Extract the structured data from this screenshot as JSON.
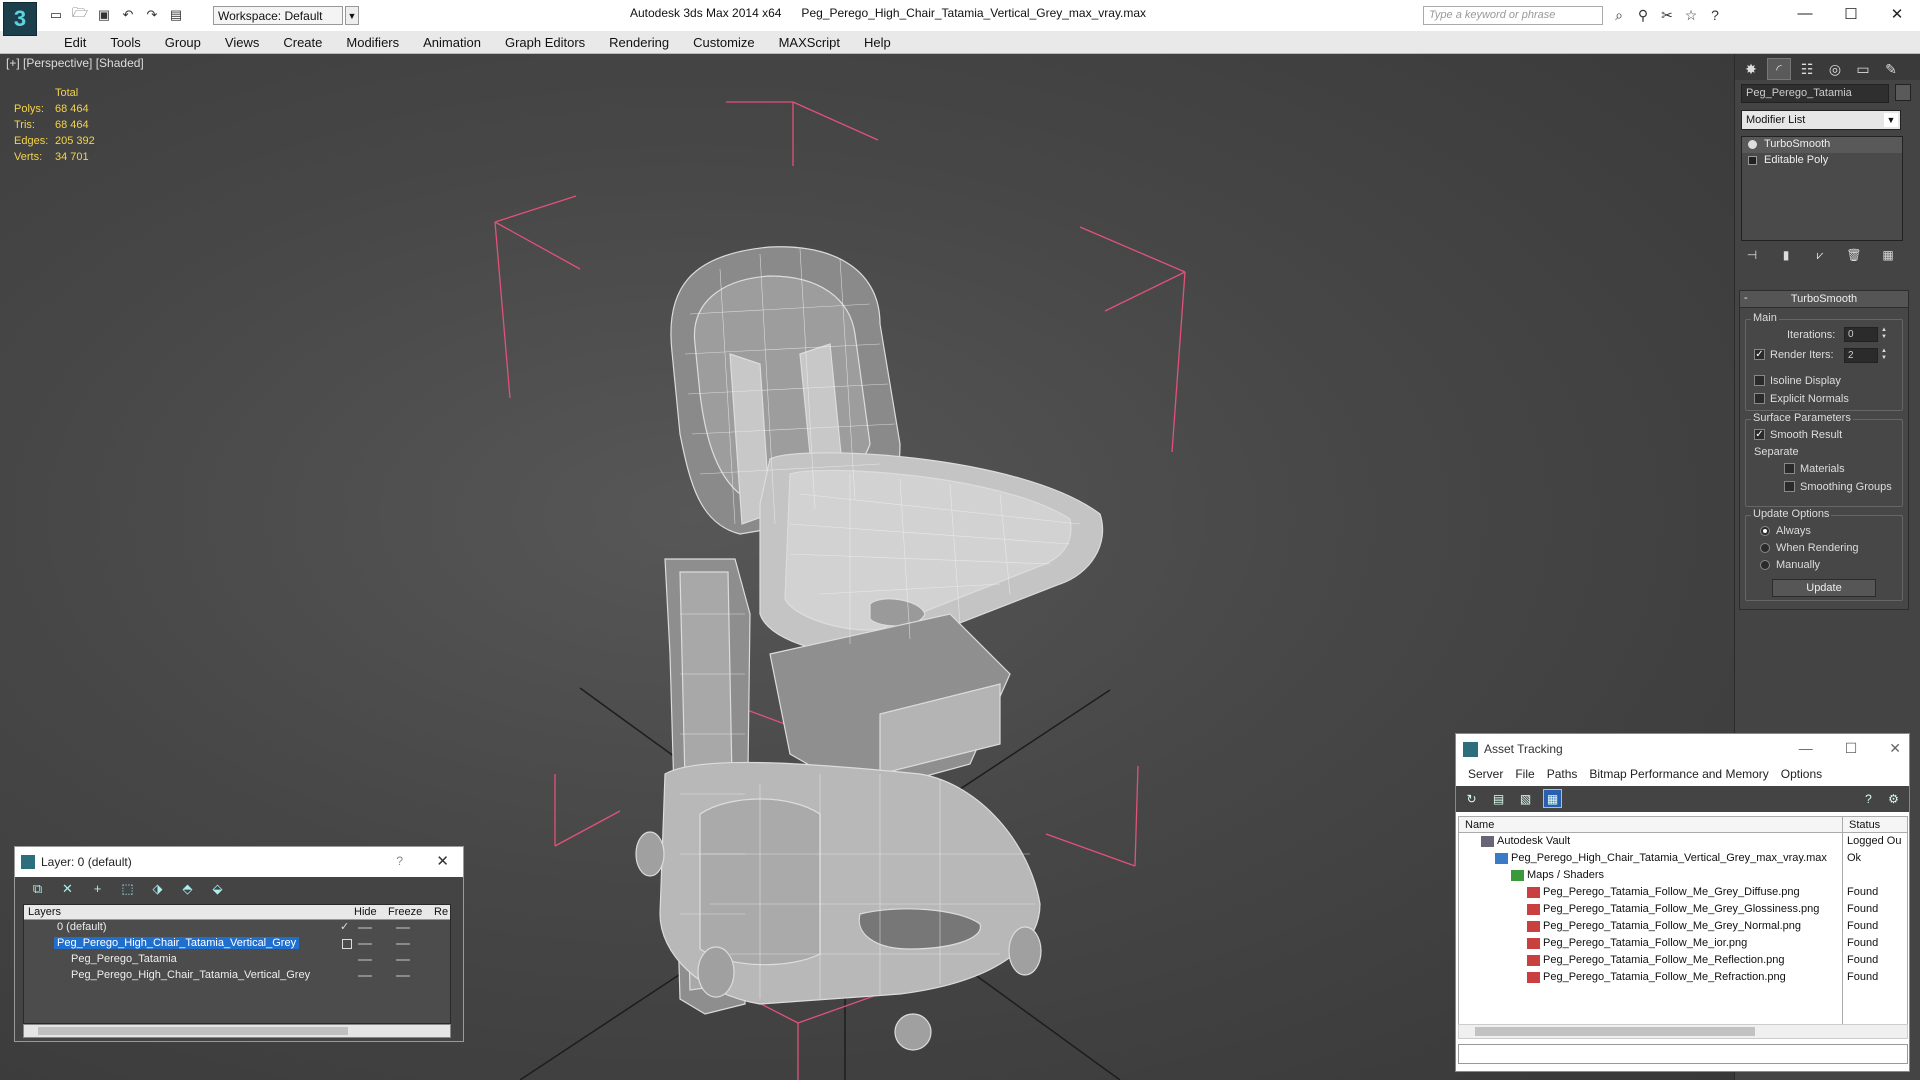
{
  "app": {
    "title": "Autodesk 3ds Max 2014 x64      Peg_Perego_High_Chair_Tatamia_Vertical_Grey_max_vray.max",
    "logo_label": "3",
    "workspace": "Workspace: Default",
    "search_placeholder": "Type a keyword or phrase",
    "window_controls": [
      "—",
      "☐",
      "✕"
    ]
  },
  "menu": [
    "Edit",
    "Tools",
    "Group",
    "Views",
    "Create",
    "Modifiers",
    "Animation",
    "Graph Editors",
    "Rendering",
    "Customize",
    "MAXScript",
    "Help"
  ],
  "viewport": {
    "label": "[+] [Perspective] [Shaded]",
    "stats": {
      "header": "Total",
      "rows": [
        {
          "k": "Polys:",
          "v": "68 464"
        },
        {
          "k": "Tris:",
          "v": "68 464"
        },
        {
          "k": "Edges:",
          "v": "205 392"
        },
        {
          "k": "Verts:",
          "v": "34 701"
        }
      ]
    }
  },
  "command_panel": {
    "object_name": "Peg_Perego_Tatamia",
    "modifier_list": "Modifier List",
    "stack": [
      "TurboSmooth",
      "Editable Poly"
    ],
    "rollout_title": "TurboSmooth",
    "main_label": "Main",
    "iterations_label": "Iterations:",
    "iterations_value": "0",
    "render_iters_label": "Render Iters:",
    "render_iters_value": "2",
    "isoline": "Isoline Display",
    "explicit_normals": "Explicit Normals",
    "surface_params": "Surface Parameters",
    "smooth_result": "Smooth Result",
    "separate": "Separate",
    "materials": "Materials",
    "smoothing_groups": "Smoothing Groups",
    "update_options": "Update Options",
    "always": "Always",
    "when_rendering": "When Rendering",
    "manually": "Manually",
    "update_button": "Update"
  },
  "layer_window": {
    "title": "Layer: 0 (default)",
    "help": "?",
    "columns": [
      "Layers",
      "Hide",
      "Freeze",
      "Re"
    ],
    "rows": [
      {
        "name": "0 (default)",
        "selected": false
      },
      {
        "name": "Peg_Perego_High_Chair_Tatamia_Vertical_Grey",
        "selected": true
      },
      {
        "name": "Peg_Perego_Tatamia",
        "selected": false
      },
      {
        "name": "Peg_Perego_High_Chair_Tatamia_Vertical_Grey",
        "selected": false
      }
    ]
  },
  "asset_tracking": {
    "title": "Asset Tracking",
    "menu": [
      "Server",
      "File",
      "Paths",
      "Bitmap Performance and Memory",
      "Options"
    ],
    "columns": [
      "Name",
      "Status"
    ],
    "rows": [
      {
        "name": "Autodesk Vault",
        "status": "Logged Ou"
      },
      {
        "name": "Peg_Perego_High_Chair_Tatamia_Vertical_Grey_max_vray.max",
        "status": "Ok"
      },
      {
        "name": "Maps / Shaders",
        "status": ""
      },
      {
        "name": "Peg_Perego_Tatamia_Follow_Me_Grey_Diffuse.png",
        "status": "Found"
      },
      {
        "name": "Peg_Perego_Tatamia_Follow_Me_Grey_Glossiness.png",
        "status": "Found"
      },
      {
        "name": "Peg_Perego_Tatamia_Follow_Me_Grey_Normal.png",
        "status": "Found"
      },
      {
        "name": "Peg_Perego_Tatamia_Follow_Me_ior.png",
        "status": "Found"
      },
      {
        "name": "Peg_Perego_Tatamia_Follow_Me_Reflection.png",
        "status": "Found"
      },
      {
        "name": "Peg_Perego_Tatamia_Follow_Me_Refraction.png",
        "status": "Found"
      }
    ]
  },
  "colors": {
    "stats_yellow": "#f3d34a",
    "bbox_pink": "#e0527a",
    "selection_blue": "#1f6fcf"
  }
}
